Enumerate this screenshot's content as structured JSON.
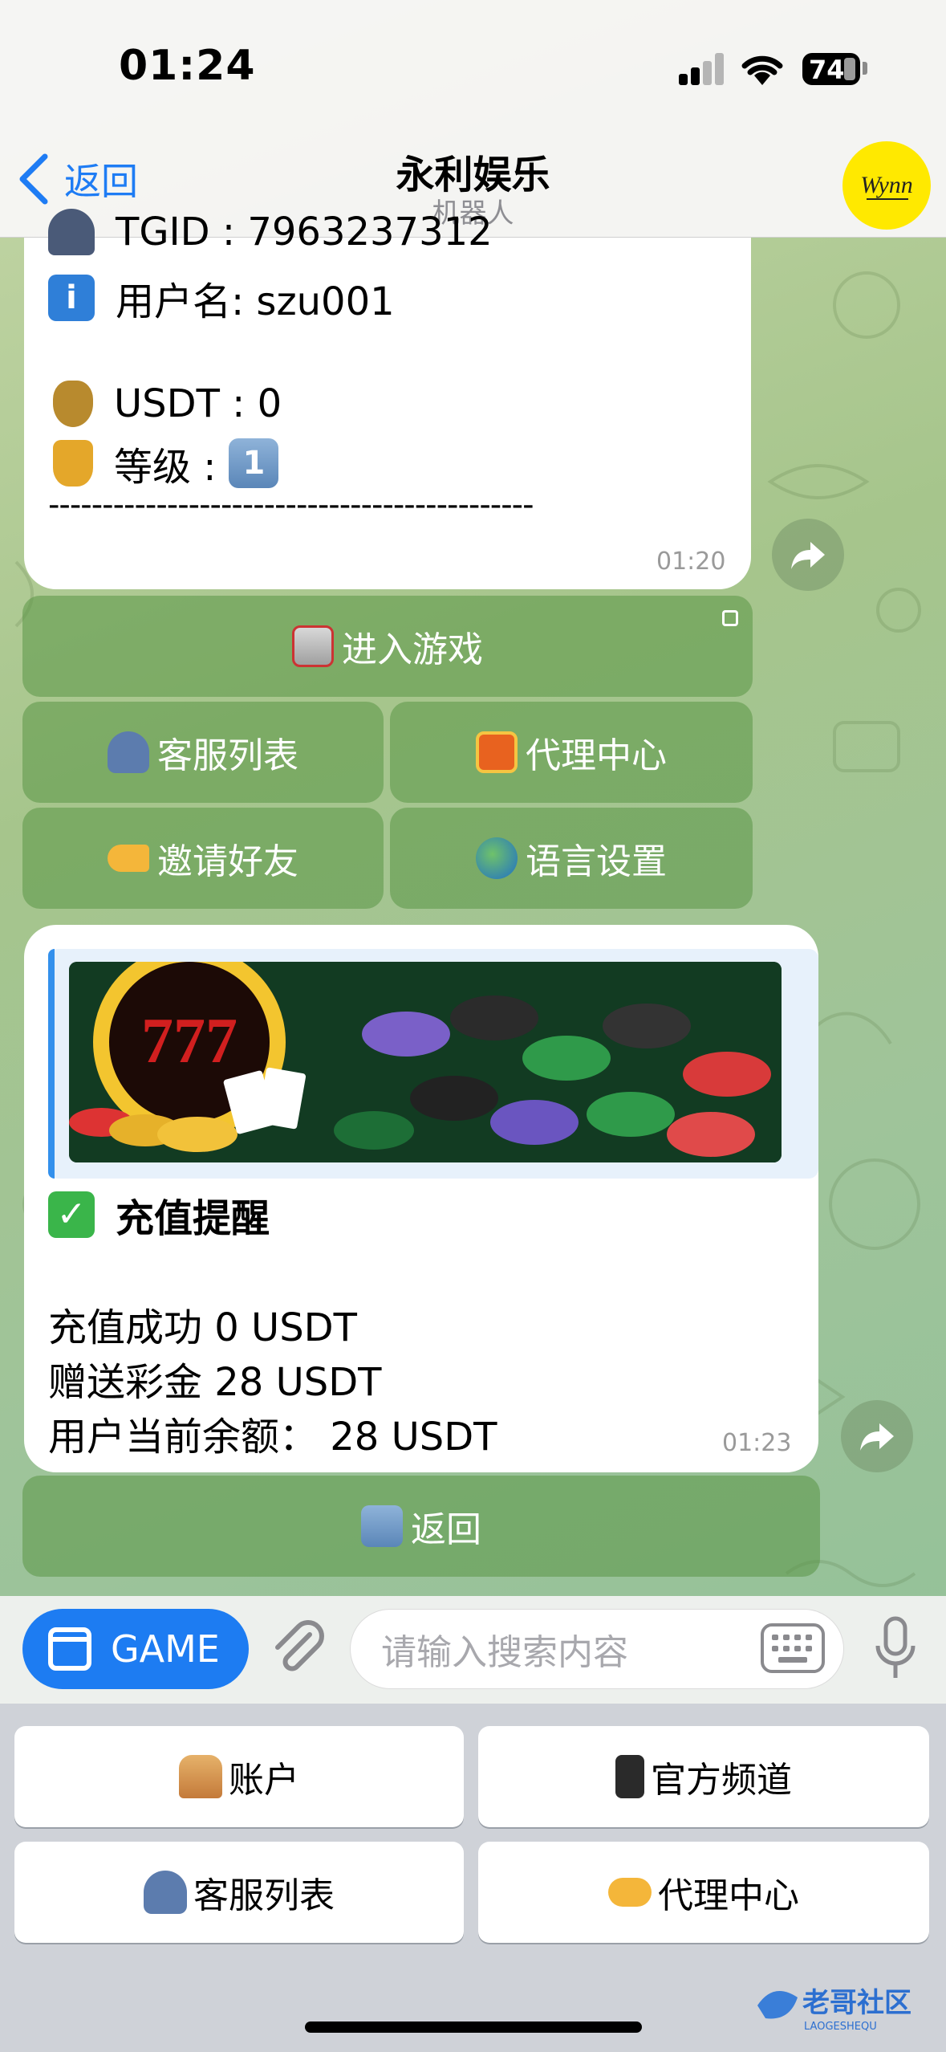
{
  "status_bar": {
    "time": "01:24",
    "battery": "74"
  },
  "nav": {
    "back_label": "返回",
    "title": "永利娱乐",
    "subtitle": "机器人",
    "avatar_text": "Wynn"
  },
  "message1": {
    "tgid_line": "TGID : 7963237312",
    "username_line": "用户名: szu001",
    "usdt_line": "USDT : 0",
    "level_label": "等级 :",
    "separator": "---------------------------------------------",
    "time": "01:20"
  },
  "inline_keyboard": {
    "enter_game": "进入游戏",
    "support_list": "客服列表",
    "agent_center": "代理中心",
    "invite_friends": "邀请好友",
    "language_settings": "语言设置"
  },
  "message2": {
    "heading": "充值提醒",
    "line1": "充值成功 0 USDT",
    "line2": "赠送彩金 28 USDT",
    "line3": "用户当前余额： 28  USDT",
    "time": "01:23",
    "banner_text": "777"
  },
  "back_inline": "返回",
  "input_bar": {
    "game_button": "GAME",
    "search_placeholder": "请输入搜索内容"
  },
  "reply_keyboard": {
    "account": "账户",
    "official_channel": "官方频道",
    "support_list": "客服列表",
    "agent_center": "代理中心"
  },
  "watermark": {
    "main": "老哥社区",
    "sub": "LAOGESHEQU"
  },
  "colors": {
    "accent_blue": "#1d7cf2",
    "inline_button": "#5a9646",
    "link_blue": "#1e7cf4"
  }
}
